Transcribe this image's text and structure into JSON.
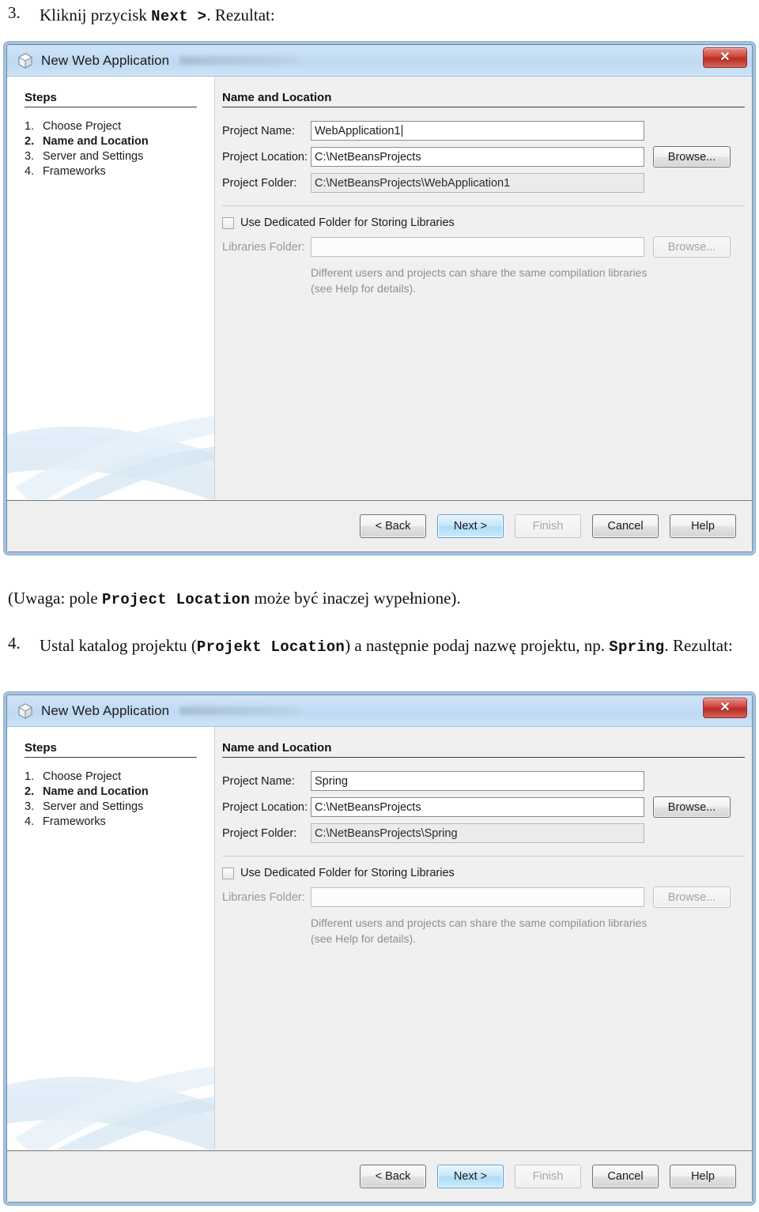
{
  "document": {
    "step3": {
      "number": "3.",
      "text_before": "Kliknij przycisk",
      "code": "Next  >",
      "text_after": ". Rezultat:"
    },
    "note": {
      "before": "(Uwaga: pole",
      "code": "Project Location",
      "after": "może być inaczej wypełnione)."
    },
    "step4": {
      "number": "4.",
      "text_before": "Ustal katalog projektu (",
      "code1": "Projekt Location",
      "text_middle": ") a następnie podaj nazwę projektu, np.",
      "code2": "Spring",
      "text_after": ". Rezultat:"
    }
  },
  "dialog": {
    "title": "New Web Application",
    "close_label": "✕",
    "steps_heading": "Steps",
    "steps": [
      {
        "num": "1.",
        "label": "Choose Project",
        "current": false
      },
      {
        "num": "2.",
        "label": "Name and Location",
        "current": true
      },
      {
        "num": "3.",
        "label": "Server and Settings",
        "current": false
      },
      {
        "num": "4.",
        "label": "Frameworks",
        "current": false
      }
    ],
    "panel_heading": "Name and Location",
    "labels": {
      "project_name": "Project Name:",
      "project_location": "Project Location:",
      "project_folder": "Project Folder:",
      "libraries_folder": "Libraries Folder:",
      "browse": "Browse...",
      "dedicated_checkbox": "Use Dedicated Folder for Storing Libraries"
    },
    "hint_line1": "Different users and projects can share the same compilation libraries",
    "hint_line2": "(see Help for details).",
    "buttons": {
      "back": "< Back",
      "next": "Next >",
      "finish": "Finish",
      "cancel": "Cancel",
      "help": "Help"
    }
  },
  "dialog1": {
    "project_name": "WebApplication1",
    "project_location": "C:\\NetBeansProjects",
    "project_folder": "C:\\NetBeansProjects\\WebApplication1",
    "libraries_folder": ""
  },
  "dialog2": {
    "project_name": "Spring",
    "project_location": "C:\\NetBeansProjects",
    "project_folder": "C:\\NetBeansProjects\\Spring",
    "libraries_folder": ""
  },
  "colors": {
    "titlebar": "#c3dcf4",
    "close_red": "#b92b22",
    "focus_blue": "#aeddf8",
    "panel_gray": "#f0f0f0"
  }
}
